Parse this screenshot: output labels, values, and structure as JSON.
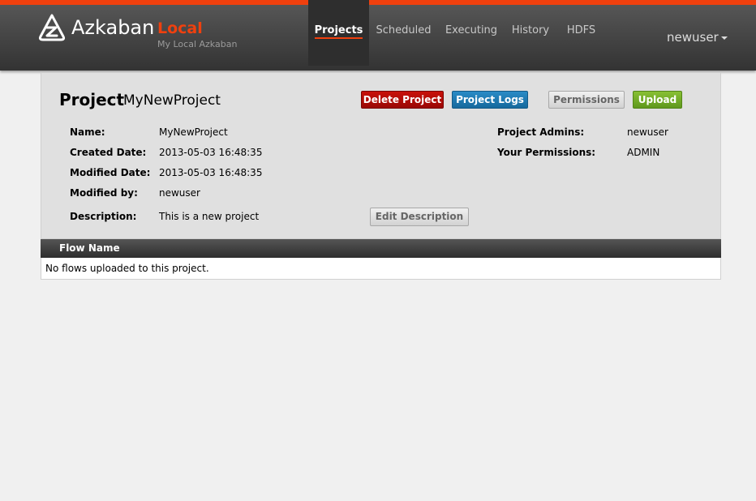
{
  "header": {
    "brand": "Azkaban",
    "env_name": "Local",
    "env_subtitle": "My Local Azkaban",
    "nav": [
      {
        "label": "Projects",
        "active": true
      },
      {
        "label": "Scheduled",
        "active": false
      },
      {
        "label": "Executing",
        "active": false
      },
      {
        "label": "History",
        "active": false
      },
      {
        "label": "HDFS",
        "active": false
      }
    ],
    "user": "newuser",
    "accent_color": "#f0400e"
  },
  "project": {
    "heading": "Project",
    "name": "MyNewProject",
    "buttons": {
      "delete": "Delete Project",
      "logs": "Project Logs",
      "permissions": "Permissions",
      "upload": "Upload",
      "edit_description": "Edit Description"
    },
    "fields": {
      "name_label": "Name:",
      "name_value": "MyNewProject",
      "created_label": "Created Date:",
      "created_value": "2013-05-03 16:48:35",
      "modified_label": "Modified Date:",
      "modified_value": "2013-05-03 16:48:35",
      "modified_by_label": "Modified by:",
      "modified_by_value": "newuser",
      "description_label": "Description:",
      "description_value": "This is a new project",
      "admins_label": "Project Admins:",
      "admins_value": "newuser",
      "permissions_label": "Your Permissions:",
      "permissions_value": "ADMIN"
    }
  },
  "flows": {
    "column_header": "Flow Name",
    "empty_message": "No flows uploaded to this project."
  }
}
